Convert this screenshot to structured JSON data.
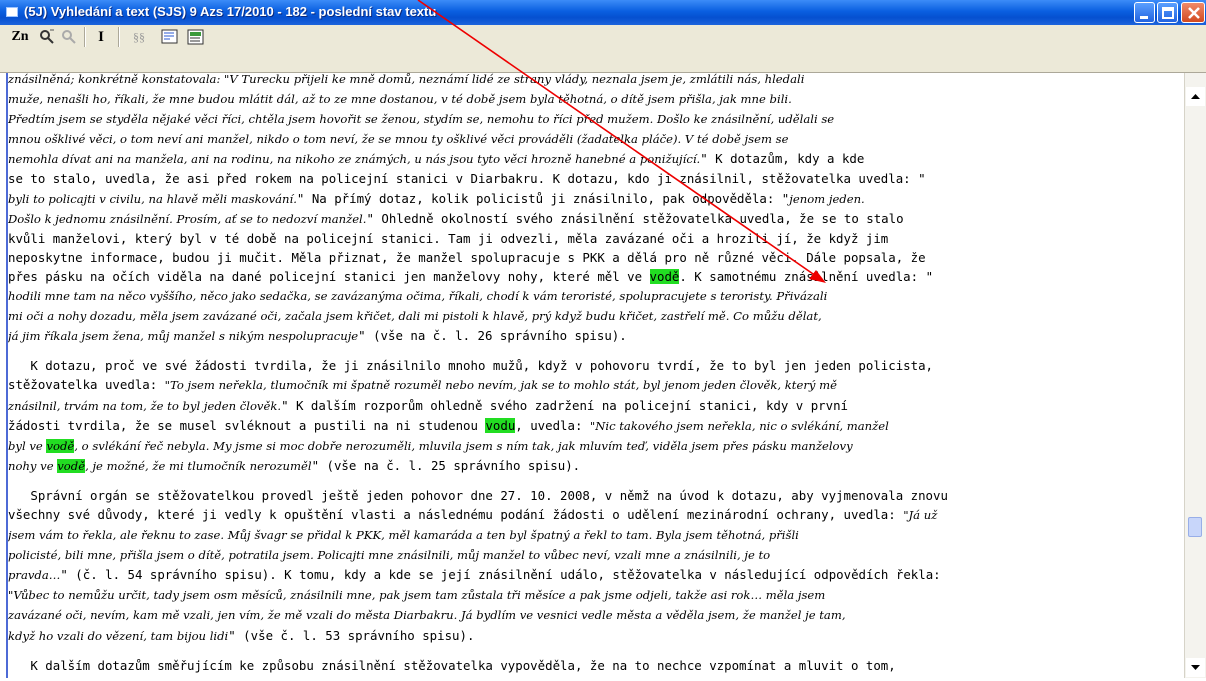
{
  "window": {
    "title": "(5J) Vyhledání a text (SJS) 9 Azs 17/2010 - 182 - poslední stav textu"
  },
  "toolbar": {
    "zn_label": "Zn",
    "italic_label": "I",
    "ss_label": "§§"
  },
  "document": {
    "lines": [
      [
        {
          "t": "znásilněná; konkrétně konstatovala: \"V Turecku přijeli ke mně domů, neznámí lidé ze strany vlády, neznala jsem je, zmlátili nás, hledali",
          "i": true
        }
      ],
      [
        {
          "t": "muže, nenašli ho, říkali, že mne budou mlátit dál, až to ze mne dostanou, v té době jsem byla těhotná, o dítě jsem přišla, jak mne bili.",
          "i": true
        }
      ],
      [
        {
          "t": "Předtím jsem se styděla nějaké věci říci, chtěla jsem hovořit se ženou, stydím se, nemohu to říci před mužem. Došlo ke znásilnění, udělali se",
          "i": true
        }
      ],
      [
        {
          "t": "mnou ošklivé věci, o tom neví ani manžel, nikdo o tom neví, že se mnou ty ošklivé věci prováděli (žadatelka pláče). V té době jsem se",
          "i": true
        }
      ],
      [
        {
          "t": "nemohla dívat ani na manžela, ani na rodinu, na nikoho ze známých, u nás jsou tyto věci hrozně hanebné a ponižující.",
          "i": true
        },
        {
          "t": "\" K dotazům, kdy a kde"
        }
      ],
      [
        {
          "t": "se to stalo, uvedla, že asi před rokem na policejní stanici v Diarbakru. K dotazu, kdo ji znásilnil, stěžovatelka uvedla: \""
        }
      ],
      [
        {
          "t": "byli to policajti v civilu, na hlavě měli maskování.",
          "i": true
        },
        {
          "t": "\" Na přímý dotaz, kolik policistů ji znásilnilo, pak odpověděla: \""
        },
        {
          "t": "jenom jeden.",
          "i": true
        }
      ],
      [
        {
          "t": "Došlo k jednomu znásilnění. Prosím, ať se to nedozví manžel.",
          "i": true
        },
        {
          "t": "\" Ohledně okolností svého znásilnění stěžovatelka uvedla, že se to stalo"
        }
      ],
      [
        {
          "t": "kvůli manželovi, který byl v té době na policejní stanici. Tam ji odvezli, měla zavázané oči a hrozili jí, že když jim"
        }
      ],
      [
        {
          "t": "neposkytne informace, budou ji mučit. Měla přiznat, že manžel spolupracuje s PKK a dělá pro ně různé věci. Dále popsala, že"
        }
      ],
      [
        {
          "t": "přes pásku na očích viděla na dané policejní stanici jen manželovy nohy, které měl ve "
        },
        {
          "t": "vodě",
          "h": true
        },
        {
          "t": ". K samotnému znásilnění uvedla: \""
        }
      ],
      [
        {
          "t": "hodili mne tam na něco vyššího, něco jako sedačka, se zavázanýma očima, říkali, chodí k vám teroristé, spolupracujete s teroristy. Přivázali",
          "i": true
        }
      ],
      [
        {
          "t": "mi oči a nohy dozadu, měla jsem zavázané oči, začala jsem křičet, dali mi pistoli k hlavě, prý když budu křičet, zastřelí mě. Co můžu dělat,",
          "i": true
        }
      ],
      [
        {
          "t": "já jim říkala jsem žena, můj manžel s nikým nespolupracuje",
          "i": true
        },
        {
          "t": "\" (vše na č. l. 26 správního spisu)."
        }
      ],
      "GAP",
      [
        {
          "t": "   K dotazu, proč ve své žádosti tvrdila, že ji znásilnilo mnoho mužů, když v pohovoru tvrdí, že to byl jen jeden policista,"
        }
      ],
      [
        {
          "t": "stěžovatelka uvedla: "
        },
        {
          "t": "\"To jsem neřekla, tlumočník mi špatně rozuměl nebo nevím, jak se to mohlo stát, byl jenom jeden člověk, který mě",
          "i": true
        }
      ],
      [
        {
          "t": "znásilnil, trvám na tom, že to byl jeden člověk.",
          "i": true
        },
        {
          "t": "\" K dalším rozporům ohledně svého zadržení na policejní stanici, kdy v první"
        }
      ],
      [
        {
          "t": "žádosti tvrdila, že se musel svléknout a pustili na ni studenou "
        },
        {
          "t": "vodu",
          "h": true
        },
        {
          "t": ", uvedla: "
        },
        {
          "t": "\"Nic takového jsem neřekla, nic o svlékání, manžel",
          "i": true
        }
      ],
      [
        {
          "t": "byl ve ",
          "i": true
        },
        {
          "t": "vodě",
          "i": true,
          "h": true
        },
        {
          "t": ", o svlékání řeč nebyla. My jsme si moc dobře nerozuměli, mluvila jsem s ním tak, jak mluvím teď, viděla jsem přes pásku manželovy",
          "i": true
        }
      ],
      [
        {
          "t": "nohy ve ",
          "i": true
        },
        {
          "t": "vodě",
          "i": true,
          "h": true
        },
        {
          "t": ", je možné, že mi tlumočník nerozuměl",
          "i": true
        },
        {
          "t": "\" (vše na č. l. 25 správního spisu)."
        }
      ],
      "GAP",
      [
        {
          "t": "   Správní orgán se stěžovatelkou provedl ještě jeden pohovor dne 27. 10. 2008, v němž na úvod k dotazu, aby vyjmenovala znovu"
        }
      ],
      [
        {
          "t": "všechny své důvody, které ji vedly k opuštění vlasti a následnému podání žádosti o udělení mezinárodní ochrany, uvedla: "
        },
        {
          "t": "\"Já už",
          "i": true
        }
      ],
      [
        {
          "t": "jsem vám to řekla, ale řeknu to zase. Můj švagr se přidal k PKK, měl kamaráda a ten byl špatný a řekl to tam. Byla jsem těhotná, přišli",
          "i": true
        }
      ],
      [
        {
          "t": "policisté, bili mne, přišla jsem o dítě, potratila jsem. Policajti mne znásilnili, můj manžel to vůbec neví, vzali mne a znásilnili, je to",
          "i": true
        }
      ],
      [
        {
          "t": "pravda…",
          "i": true
        },
        {
          "t": "\" (č. l. 54 správního spisu). K tomu, kdy a kde se její znásilnění událo, stěžovatelka v následující odpovědích řekla:"
        }
      ],
      [
        {
          "t": "\"Vůbec to nemůžu určit, tady jsem osm měsíců, znásilnili mne, pak jsem tam zůstala tři měsíce a pak jsme odjeli, takže asi rok… měla jsem",
          "i": true
        }
      ],
      [
        {
          "t": "zavázané oči, nevím, kam mě vzali, jen vím, že mě vzali do města Diarbakru. Já bydlím ve vesnici vedle města a věděla jsem, že manžel je tam,",
          "i": true
        }
      ],
      [
        {
          "t": "když ho vzali do vězení, tam bijou lidi",
          "i": true
        },
        {
          "t": "\" (vše č. l. 53 správního spisu)."
        }
      ],
      "GAP",
      [
        {
          "t": "   K dalším dotazům směřujícím ke způsobu znásilnění stěžovatelka vypověděla, že na to nechce vzpomínat a mluvit o tom,"
        }
      ]
    ]
  },
  "colors": {
    "highlight": "#22dd22",
    "annotation_arrow": "#ee0000"
  }
}
